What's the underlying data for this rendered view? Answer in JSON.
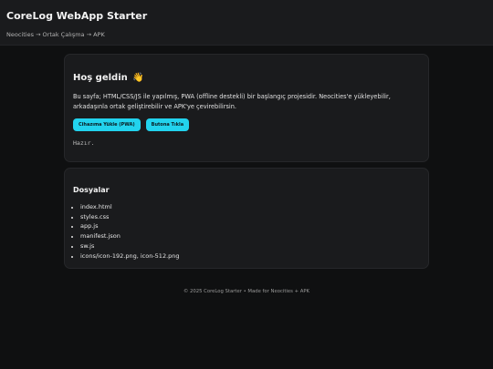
{
  "header": {
    "title": "CoreLog WebApp Starter",
    "breadcrumb": "Neocities → Ortak Çalışma → APK"
  },
  "welcome": {
    "title": "Hoş geldin",
    "emoji": "👋",
    "intro": "Bu sayfa; HTML/CSS/JS ile yapılmış, PWA (offline destekli) bir başlangıç projesidir. Neocities'e yükleyebilir, arkadaşınla ortak geliştirebilir ve APK'ye çevirebilirsin.",
    "install_button": "Cihazıma Yükle (PWA)",
    "click_button": "Butona Tıkla",
    "status": "Hazır."
  },
  "files": {
    "title": "Dosyalar",
    "items": [
      "index.html",
      "styles.css",
      "app.js",
      "manifest.json",
      "sw.js",
      "icons/icon-192.png, icon-512.png"
    ]
  },
  "footer": {
    "text": "© 2025 CoreLog Starter • Made for Neocities + APK"
  },
  "colors": {
    "background": "#0f1011",
    "card": "#1a1b1d",
    "accent": "#22d3ee"
  }
}
